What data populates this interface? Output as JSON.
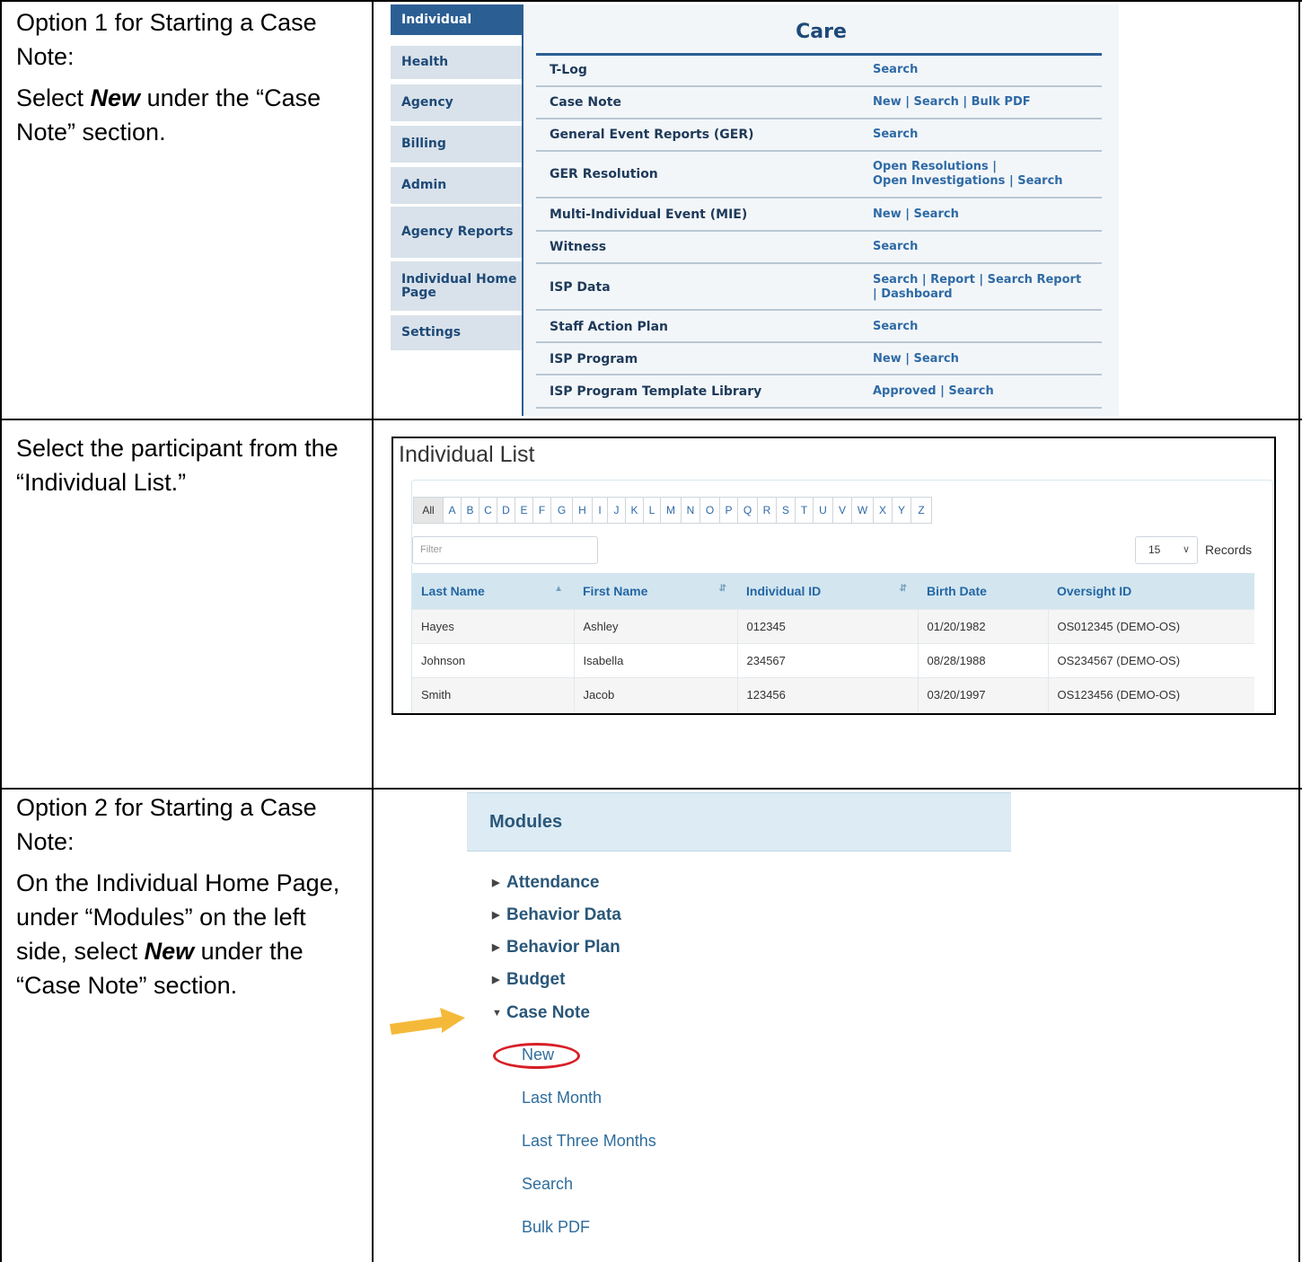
{
  "rows": {
    "option1": {
      "heading": "Option 1 for Starting a Case Note:",
      "instruction_pre": "Select ",
      "instruction_em": "New",
      "instruction_post": " under the “Case Note” section."
    },
    "select_participant": {
      "text": "Select the participant from the “Individual List.”"
    },
    "option2": {
      "heading": "Option 2 for Starting a Case Note:",
      "instruction_pre": "On the Individual Home Page, under “Modules” on the left side, select ",
      "instruction_em": "New",
      "instruction_post": " under the “Case Note” section."
    }
  },
  "care_menu": {
    "tabs": [
      "Individual",
      "Health",
      "Agency",
      "Billing",
      "Admin",
      "Agency Reports",
      "Individual Home Page",
      "Settings"
    ],
    "active_tab": "Individual",
    "title": "Care",
    "rows": [
      {
        "name": "T-Log",
        "links": [
          "Search"
        ]
      },
      {
        "name": "Case Note",
        "links": [
          "New | Search | Bulk PDF"
        ]
      },
      {
        "name": "General Event Reports (GER)",
        "links": [
          "Search"
        ]
      },
      {
        "name": "GER Resolution",
        "links": [
          "Open Resolutions |",
          "Open Investigations | Search"
        ]
      },
      {
        "name": "Multi-Individual Event (MIE)",
        "links": [
          "New | Search"
        ]
      },
      {
        "name": "Witness",
        "links": [
          "Search"
        ]
      },
      {
        "name": "ISP Data",
        "links": [
          "Search | Report | Search Report",
          "| Dashboard"
        ]
      },
      {
        "name": "Staff Action Plan",
        "links": [
          "Search"
        ]
      },
      {
        "name": "ISP Program",
        "links": [
          "New | Search"
        ]
      },
      {
        "name": "ISP Program Template Library",
        "links": [
          "Approved | Search"
        ]
      }
    ]
  },
  "individual_list": {
    "title": "Individual List",
    "letters": [
      "All",
      "A",
      "B",
      "C",
      "D",
      "E",
      "F",
      "G",
      "H",
      "I",
      "J",
      "K",
      "L",
      "M",
      "N",
      "O",
      "P",
      "Q",
      "R",
      "S",
      "T",
      "U",
      "V",
      "W",
      "X",
      "Y",
      "Z"
    ],
    "active_letter": "All",
    "filter_placeholder": "Filter",
    "records_value": "15",
    "records_label": "Records",
    "columns": [
      "Last Name",
      "First Name",
      "Individual ID",
      "Birth Date",
      "Oversight ID"
    ],
    "rows": [
      [
        "Hayes",
        "Ashley",
        "012345",
        "01/20/1982",
        "OS012345 (DEMO-OS)"
      ],
      [
        "Johnson",
        "Isabella",
        "234567",
        "08/28/1988",
        "OS234567 (DEMO-OS)"
      ],
      [
        "Smith",
        "Jacob",
        "123456",
        "03/20/1997",
        "OS123456 (DEMO-OS)"
      ]
    ]
  },
  "modules": {
    "title": "Modules",
    "items": [
      "Attendance",
      "Behavior Data",
      "Behavior Plan",
      "Budget"
    ],
    "expanded_item": "Case Note",
    "sub_items": [
      "New",
      "Last Month",
      "Last Three Months",
      "Search",
      "Bulk PDF"
    ],
    "highlight_color": "#d71f26",
    "arrow_color": "#f5b93a"
  }
}
